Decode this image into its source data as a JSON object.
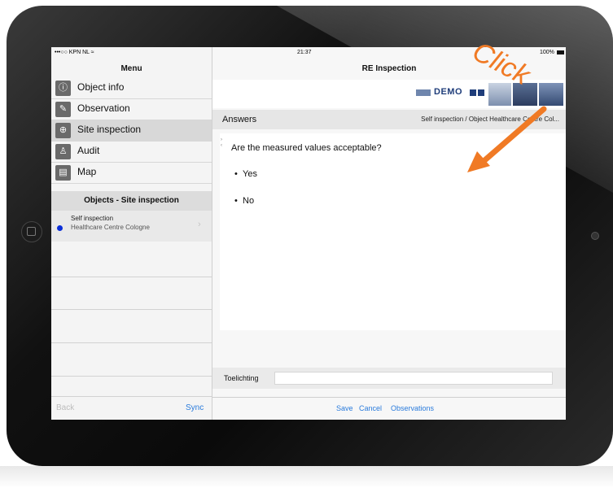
{
  "status_bar": {
    "carrier": "•••○○ KPN NL ≈",
    "time": "21:37",
    "battery": "100%"
  },
  "menu": {
    "title": "Menu",
    "items": [
      {
        "label": "Object info",
        "icon": "info-icon",
        "selected": false
      },
      {
        "label": "Observation",
        "icon": "pencil-icon",
        "selected": false
      },
      {
        "label": "Site inspection",
        "icon": "magnifier-icon",
        "selected": true
      },
      {
        "label": "Audit",
        "icon": "audit-icon",
        "selected": false
      },
      {
        "label": "Map",
        "icon": "map-icon",
        "selected": false
      }
    ],
    "objects_header": "Objects - Site inspection",
    "object": {
      "title": "Self inspection",
      "subtitle": "Healthcare Centre Cologne",
      "dot_color": "#0a2ed8"
    },
    "back_label": "Back",
    "sync_label": "Sync"
  },
  "detail": {
    "title": "RE Inspection",
    "banner_text": "DEMO",
    "answers_label": "Answers",
    "answers_path": "Self inspection / Object Healthcare Centre Col...",
    "question": "Are the measured values acceptable?",
    "answers": [
      "Yes",
      "No"
    ],
    "toelichting_label": "Toelichting",
    "actions": {
      "save": "Save",
      "cancel": "Cancel",
      "observations": "Observations"
    }
  },
  "annotation": {
    "text": "Click",
    "color": "#f07a25"
  }
}
